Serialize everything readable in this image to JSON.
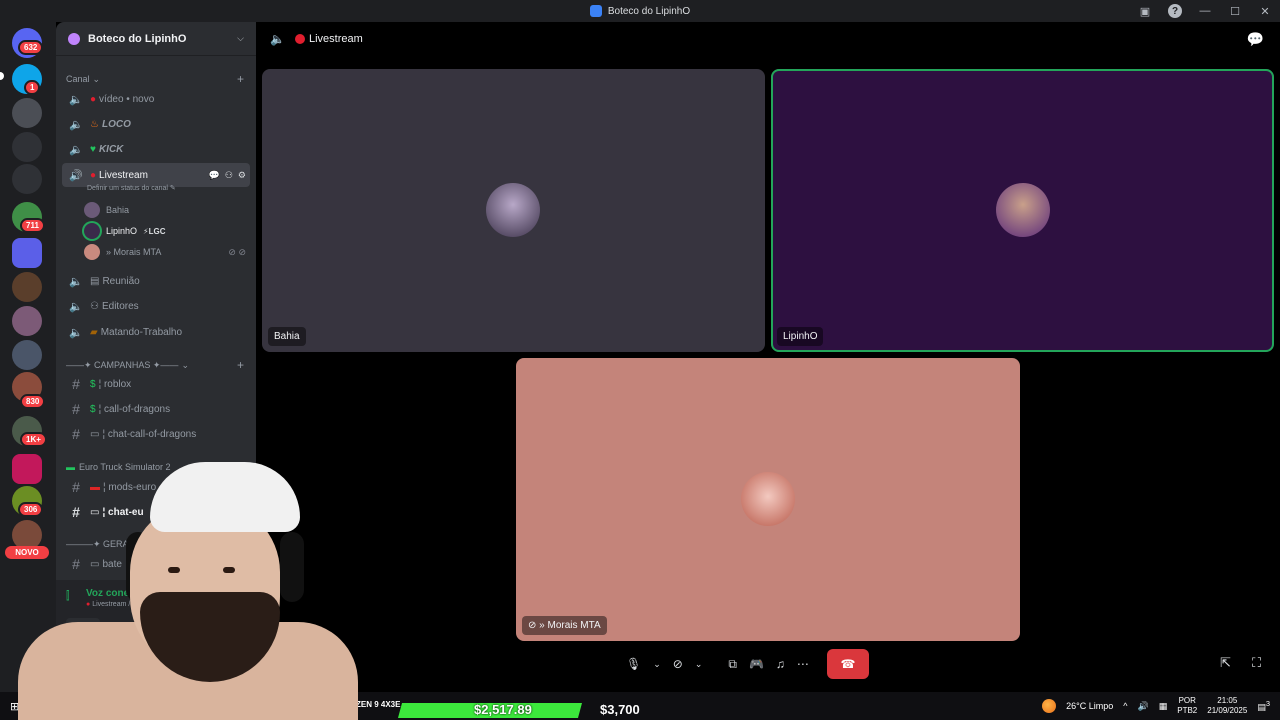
{
  "window": {
    "title": "Boteco do LipinhO"
  },
  "guild": {
    "name": "Boteco do LipinhO"
  },
  "rail_badges": [
    "632",
    "1",
    "711",
    "830",
    "1K+",
    "306",
    "NOVO"
  ],
  "categories": {
    "canal": "Canal",
    "campanhas": "——✦ CAMPANHAS ✦——",
    "euro_truck": "Euro Truck Simulator 2",
    "geral": "———✦ GERAL"
  },
  "channels": {
    "video_novo": "vídeo • novo",
    "loco": "LOCO",
    "kick": "KICK",
    "livestream": "Livestream",
    "reuniao": "Reunião",
    "editores": "Editores",
    "matando_trabalho": "Matando-Trabalho",
    "roblox": "¦ roblox",
    "call_of_dragons": "¦ call-of-dragons",
    "chat_call_of_dragons": "¦ chat-call-of-dragons",
    "mods_euro": "¦ mods-euro",
    "chat_euro": "¦ chat-eu",
    "bate_papo": "bate"
  },
  "channel_status_hint": "Definir um status do canal",
  "voice_users": [
    {
      "name": "Bahia",
      "tag": ""
    },
    {
      "name": "LipinhO",
      "tag": "⚡LGC"
    },
    {
      "name": "» Morais MTA",
      "tag": ""
    }
  ],
  "voice_panel": {
    "status": "Voz conectada",
    "location": "Livestream / Boteco do"
  },
  "call": {
    "title": "Livestream",
    "tiles": [
      {
        "name": "Bahia",
        "bg": "#37343f"
      },
      {
        "name": "LipinhO",
        "bg": "#2d1040"
      },
      {
        "name": "» Morais MTA",
        "bg": "#c4847a"
      }
    ]
  },
  "overlay": {
    "amount_primary": "$2,517.89",
    "amount_secondary": "$3,700",
    "tag": "ZEN 9 4X3E"
  },
  "taskbar": {
    "weather": "26°C  Limpo",
    "lang_top": "POR",
    "lang_bottom": "PTB2",
    "time": "21:05",
    "date": "21/09/2025",
    "notif_count": "3"
  }
}
